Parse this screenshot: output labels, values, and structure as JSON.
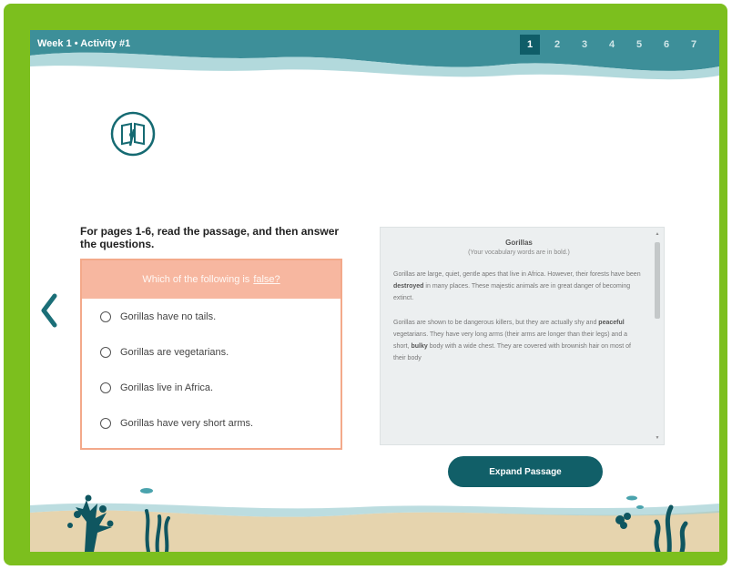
{
  "header": {
    "title": "Week 1 • Activity #1",
    "pages": [
      "1",
      "2",
      "3",
      "4",
      "5",
      "6",
      "7"
    ],
    "active_page": "1"
  },
  "activity_icon": "book-pen-icon",
  "instruction": "For pages 1-6, read the passage, and then answer the questions.",
  "question": {
    "prompt": "Which of the following is",
    "prompt_emphasis": "false?",
    "options": [
      "Gorillas have no tails.",
      "Gorillas are vegetarians.",
      "Gorillas live in Africa.",
      "Gorillas have very short arms."
    ]
  },
  "passage": {
    "title": "Gorillas",
    "subtitle": "(Your vocabulary words are in bold.)",
    "para1_a": "Gorillas are large, quiet, gentle apes that live in Africa. However, their forests have been",
    "para1_bold": "destroyed",
    "para1_b": "in many places. These majestic animals are in great danger of becoming extinct.",
    "para2_a": "Gorillas are shown to be dangerous killers, but they are actually shy and",
    "para2_bold1": "peaceful",
    "para2_b": "vegetarians. They have very long arms (their arms are longer than their legs) and a short,",
    "para2_bold2": "bulky",
    "para2_c": "body with a wide chest. They are covered with brownish hair on most of their body"
  },
  "expand_button": "Expand Passage",
  "nav": {
    "prev_icon": "chevron-left-icon"
  },
  "colors": {
    "frame": "#7cbf1e",
    "header_teal": "#3d8f99",
    "button": "#115f68",
    "question_header": "#f7b7a0",
    "sand": "#e6d4ae"
  }
}
